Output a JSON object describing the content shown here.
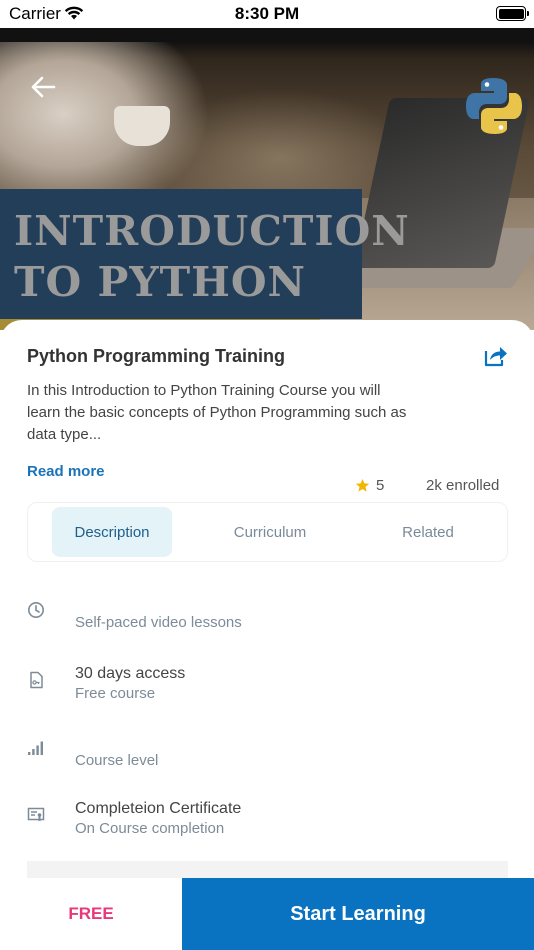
{
  "status_bar": {
    "carrier": "Carrier",
    "time": "8:30 PM"
  },
  "hero": {
    "title_line1": "INTRODUCTION",
    "title_line2": "TO PYTHON"
  },
  "course": {
    "title": "Python Programming Training",
    "description": "In this Introduction to Python Training Course you will learn the basic concepts of Python Programming such as data type...",
    "read_more_label": "Read more",
    "rating": "5",
    "enrolled": "2k enrolled"
  },
  "tabs": [
    {
      "label": "Description",
      "active": true
    },
    {
      "label": "Curriculum",
      "active": false
    },
    {
      "label": "Related",
      "active": false
    }
  ],
  "features": [
    {
      "icon": "clock-icon",
      "title": "",
      "subtitle": "Self-paced video lessons"
    },
    {
      "icon": "file-document-icon",
      "title": "30 days access",
      "subtitle": "Free course"
    },
    {
      "icon": "signal-level-icon",
      "title": "",
      "subtitle": "Course level"
    },
    {
      "icon": "certificate-icon",
      "title": "Completeion Certificate",
      "subtitle": "On Course completion"
    }
  ],
  "footer": {
    "price_label": "FREE",
    "cta_label": "Start Learning"
  },
  "colors": {
    "accent": "#0a73c1",
    "link": "#1b73b8",
    "price": "#e8387a",
    "tab_active_bg": "#e3f3f8",
    "banner": "#233e58",
    "star": "#f2b705"
  }
}
